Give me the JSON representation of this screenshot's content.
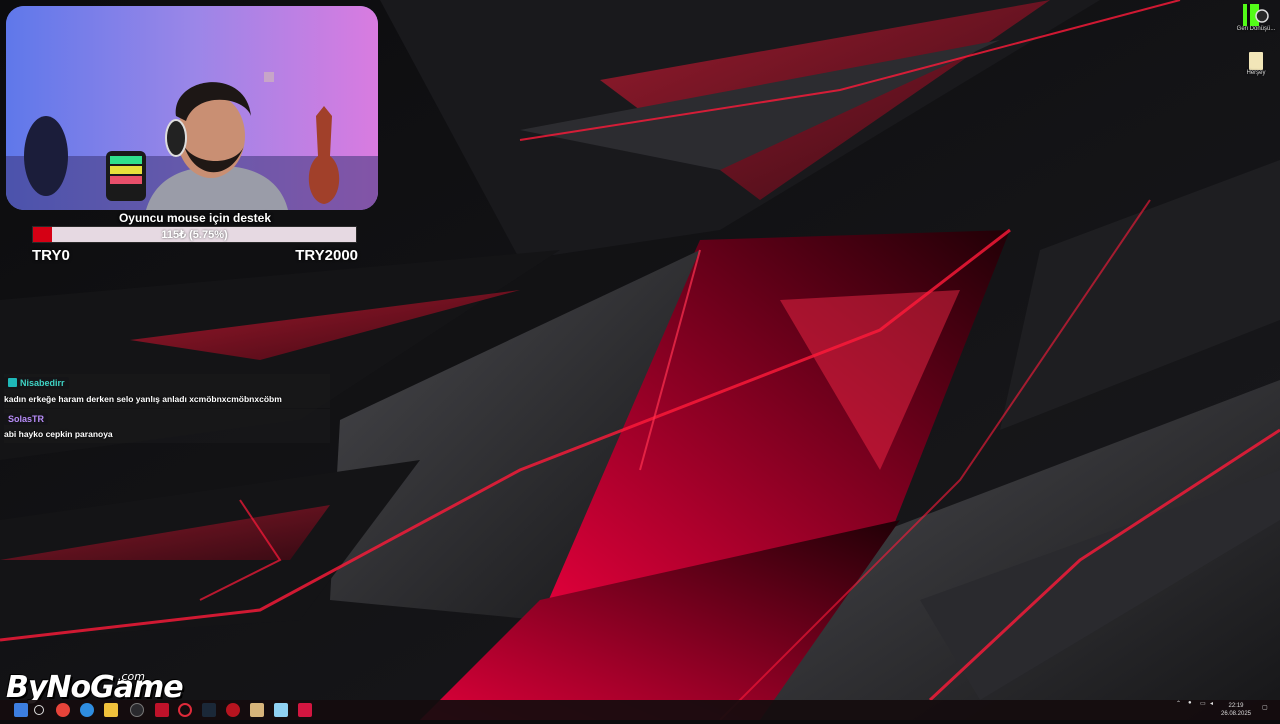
{
  "stream": {
    "goal": {
      "title": "Oyuncu mouse için destek",
      "progress_text": "115₺ (5.75%)",
      "progress_fraction": 0.0575,
      "min_label": "TRY0",
      "max_label": "TRY2000"
    },
    "chat": [
      {
        "user": "Nisabedirr",
        "user_color": "#3fd3c5",
        "message": "kadın erkeğe haram derken selo yanlış anladı xcmöbnxcmöbnxcöbm"
      },
      {
        "user": "SolasTR",
        "user_color": "#b78cf7",
        "message": "abi hayko cepkin paranoya"
      }
    ],
    "watermark": {
      "brand": "ByNoGame",
      "suffix": ".com"
    }
  },
  "desktop": {
    "icons": [
      {
        "name": "kick-icon",
        "label": "Geri Dönüşü..."
      },
      {
        "name": "file-icon",
        "label": "Herşey"
      }
    ]
  },
  "taskbar": {
    "apps": [
      "start-icon",
      "search-icon",
      "chrome-icon",
      "edge-icon",
      "explorer-icon",
      "app-red-icon",
      "app-icon",
      "opera-icon",
      "steam-icon",
      "app-icon",
      "app-icon",
      "app-icon",
      "app-icon"
    ],
    "clock": {
      "time": "22:19",
      "date": "26.08.2025"
    }
  },
  "colors": {
    "accent": "#d50014",
    "wallpaper_base": "#0b0b0d"
  }
}
